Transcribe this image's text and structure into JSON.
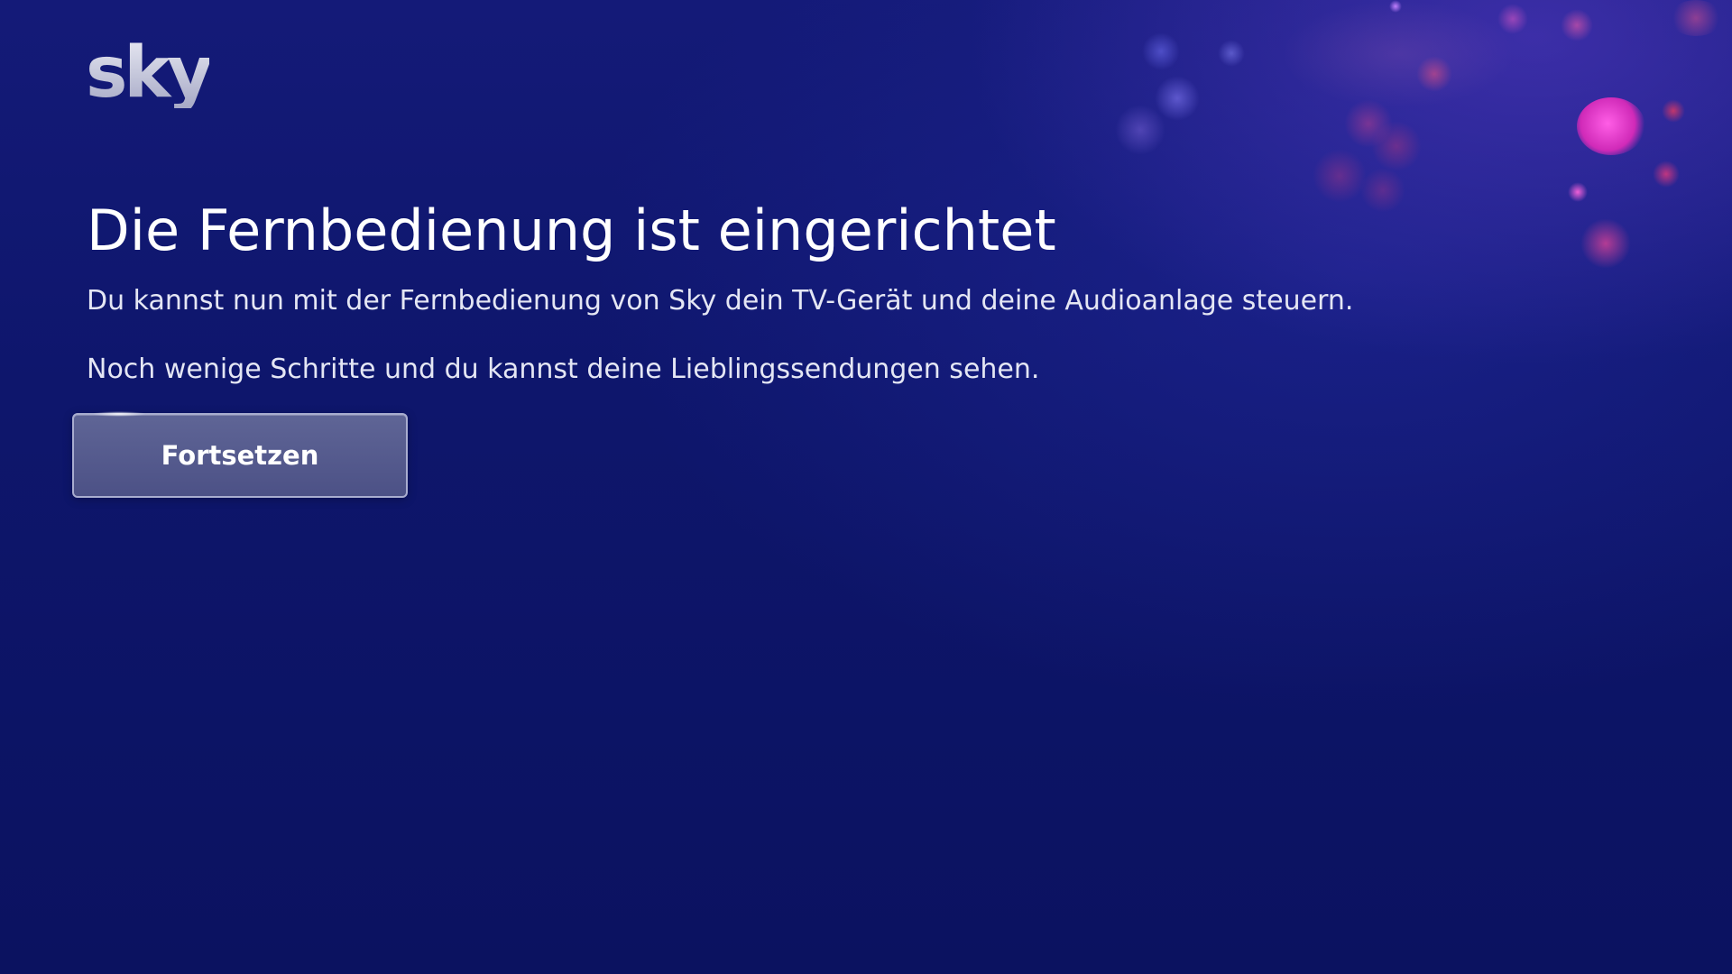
{
  "brand": {
    "logo_text": "sky"
  },
  "screen": {
    "title": "Die Fernbedienung ist eingerichtet",
    "line1": "Du kannst nun mit der Fernbedienung von Sky dein TV-Gerät und deine Audioanlage steuern.",
    "line2": "Noch wenige Schritte und du kannst deine Lieblingssendungen sehen."
  },
  "actions": {
    "continue_label": "Fortsetzen"
  },
  "colors": {
    "background": "#0e166c",
    "accent_magenta": "#e040c8",
    "text": "#ffffff"
  }
}
